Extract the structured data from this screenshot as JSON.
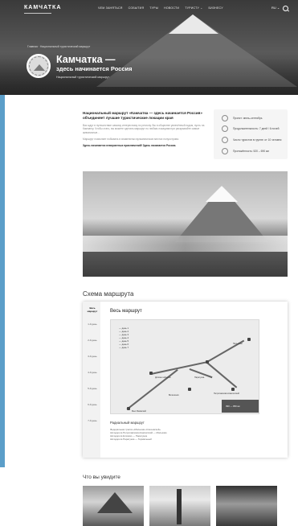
{
  "header": {
    "logo": "КАМЧАТКА",
    "menu": [
      "ЧЕМ ЗАНЯТЬСЯ",
      "СОБЫТИЯ",
      "ТУРЫ",
      "НОВОСТИ",
      "ТУРИСТУ ⌄",
      "БИЗНЕСУ"
    ],
    "lang": "RU ⌄",
    "breadcrumb": "Главная · Национальный туристический маршрут",
    "title": "Камчатка —",
    "subtitle": "здесь начинается Россия",
    "small": "Национальный туристический маршрут"
  },
  "intro": {
    "heading": "Национальный маршрут «Камчатка — здесь начинается Россия» объединяет лучшие туристические локации края",
    "p1": "Вас ждут в путешествие самому интересному по региону. Вы в обществе увлечённый гидом, пусть на Камчатку. Чтобы стать, вы можете сделать маршрут по любым локациям при раскрывайте самые живописные...",
    "p2": "Маршрут позволяет побывать в знаменитых вулканических местах полуострова.",
    "cta": "Здесь начинается невероятных приключений! Здесь начинается Россия."
  },
  "facts": [
    {
      "icon": "calendar-icon",
      "text": "Проект: июнь–сентябрь"
    },
    {
      "icon": "clock-icon",
      "text": "Продолжительность: 7 дней / 6 ночей"
    },
    {
      "icon": "group-icon",
      "text": "Число туристов в группе: от 10 человек"
    },
    {
      "icon": "road-icon",
      "text": "Протяжённость: 520 – 690 км"
    }
  ],
  "route": {
    "section_title": "Схема маршрута",
    "days": [
      "Весь маршрут",
      "1-й день",
      "2-й день",
      "3-й день",
      "4-й день",
      "5-й день",
      "6-й день",
      "7-й день"
    ],
    "active_day": "Весь маршрут",
    "title": "Весь маршрут",
    "legend": [
      "— день 1",
      "— день 2",
      "— день 3",
      "— день 4",
      "— день 5",
      "— день 6",
      "— день 7"
    ],
    "map_labels": [
      "Долина гейзеров",
      "Вилючинск",
      "Мыс Раковский",
      "Петропавловск-Камчатский",
      "Налычево",
      "Паратунка"
    ],
    "distance": "390 — 950 км",
    "radial_title": "Радиальный маршрут",
    "radial_lines": [
      "Федеральная трасса «Мильково–Ключевской»",
      "Автодорога Петропавловск-Камчатский — Мильково",
      "Автодорога Елизово — Паратунка",
      "Автодорога Паратунка — Термальный"
    ]
  },
  "see": {
    "section_title": "Что вы увидите"
  }
}
